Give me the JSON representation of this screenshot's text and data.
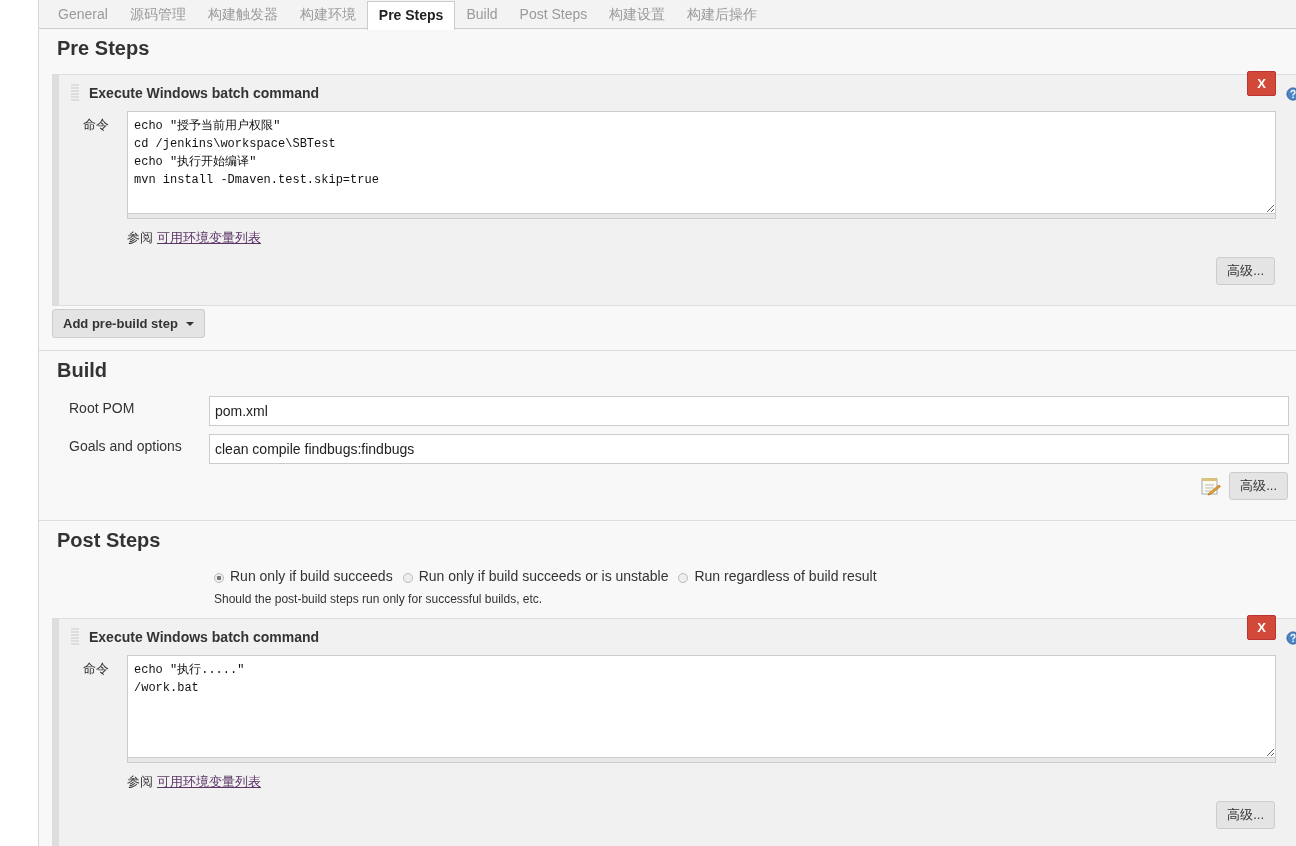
{
  "tabs": [
    {
      "label": "General",
      "selected": false
    },
    {
      "label": "源码管理",
      "selected": false
    },
    {
      "label": "构建触发器",
      "selected": false
    },
    {
      "label": "构建环境",
      "selected": false
    },
    {
      "label": "Pre Steps",
      "selected": true
    },
    {
      "label": "Build",
      "selected": false
    },
    {
      "label": "Post Steps",
      "selected": false
    },
    {
      "label": "构建设置",
      "selected": false
    },
    {
      "label": "构建后操作",
      "selected": false
    }
  ],
  "pre_steps": {
    "title": "Pre Steps",
    "steps": [
      {
        "title": "Execute Windows batch command",
        "delete_button": "X",
        "command_label": "命令",
        "command": "echo ″授予当前用户权限″\ncd /jenkins\\workspace\\SBTest\necho ″执行开始编译″\nmvn install -Dmaven.test.skip=true",
        "see_also": "参阅",
        "env_link": "可用环境变量列表",
        "advanced_button": "高级..."
      }
    ],
    "add_button": "Add pre-build step"
  },
  "build": {
    "title": "Build",
    "fields": [
      {
        "label": "Root POM",
        "value": "pom.xml"
      },
      {
        "label": "Goals and options",
        "value": "clean compile findbugs:findbugs"
      }
    ],
    "advanced_button": "高级..."
  },
  "post_steps": {
    "title": "Post Steps",
    "options": [
      {
        "label": "Run only if build succeeds",
        "selected": true
      },
      {
        "label": "Run only if build succeeds or is unstable",
        "selected": false
      },
      {
        "label": "Run regardless of build result",
        "selected": false
      }
    ],
    "hint": "Should the post-build steps run only for successful builds, etc.",
    "steps": [
      {
        "title": "Execute Windows batch command",
        "delete_button": "X",
        "command_label": "命令",
        "command": "echo ″执行.....″\n/work.bat",
        "see_also": "参阅",
        "env_link": "可用环境变量列表",
        "advanced_button": "高级..."
      }
    ]
  }
}
